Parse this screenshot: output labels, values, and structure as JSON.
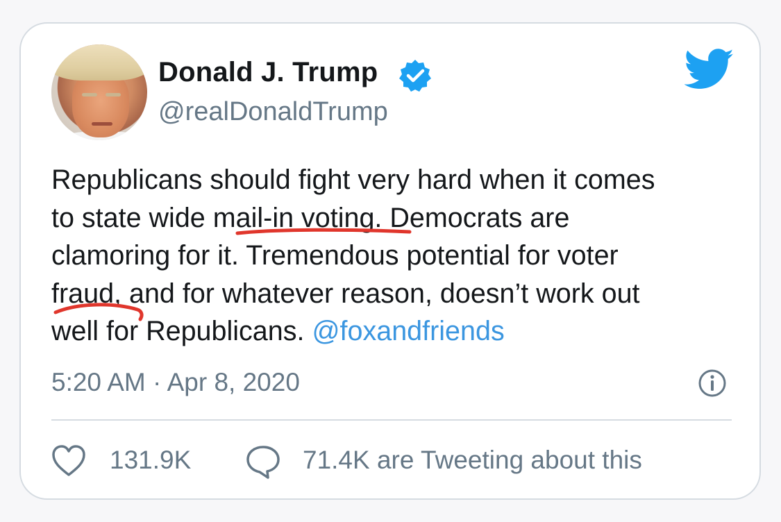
{
  "tweet": {
    "author_name": "Donald J. Trump",
    "handle": "@realDonaldTrump",
    "text_lines": [
      "Republicans should fight very hard when it comes",
      "to state wide mail-in voting. Democrats are",
      "clamoring for it. Tremendous potential for voter",
      "fraud, and for whatever reason,  doesn’t work out"
    ],
    "last_line_text": "well for Republicans. ",
    "mention": "@foxandfriends",
    "timestamp": "5:20 AM · Apr 8, 2020",
    "like_count": "131.9K",
    "retweet_text": "71.4K are Tweeting about this"
  },
  "icons": {
    "verified": "verified-badge-icon",
    "brand": "twitter-bird-icon",
    "info": "info-icon",
    "like": "heart-icon",
    "reply": "speech-bubble-icon"
  },
  "colors": {
    "text": "#14171a",
    "secondary": "#657786",
    "link": "#3b96e0",
    "twitter_blue": "#1da1f2",
    "annotation_red": "#e0362c",
    "border": "#d5dbe1"
  }
}
